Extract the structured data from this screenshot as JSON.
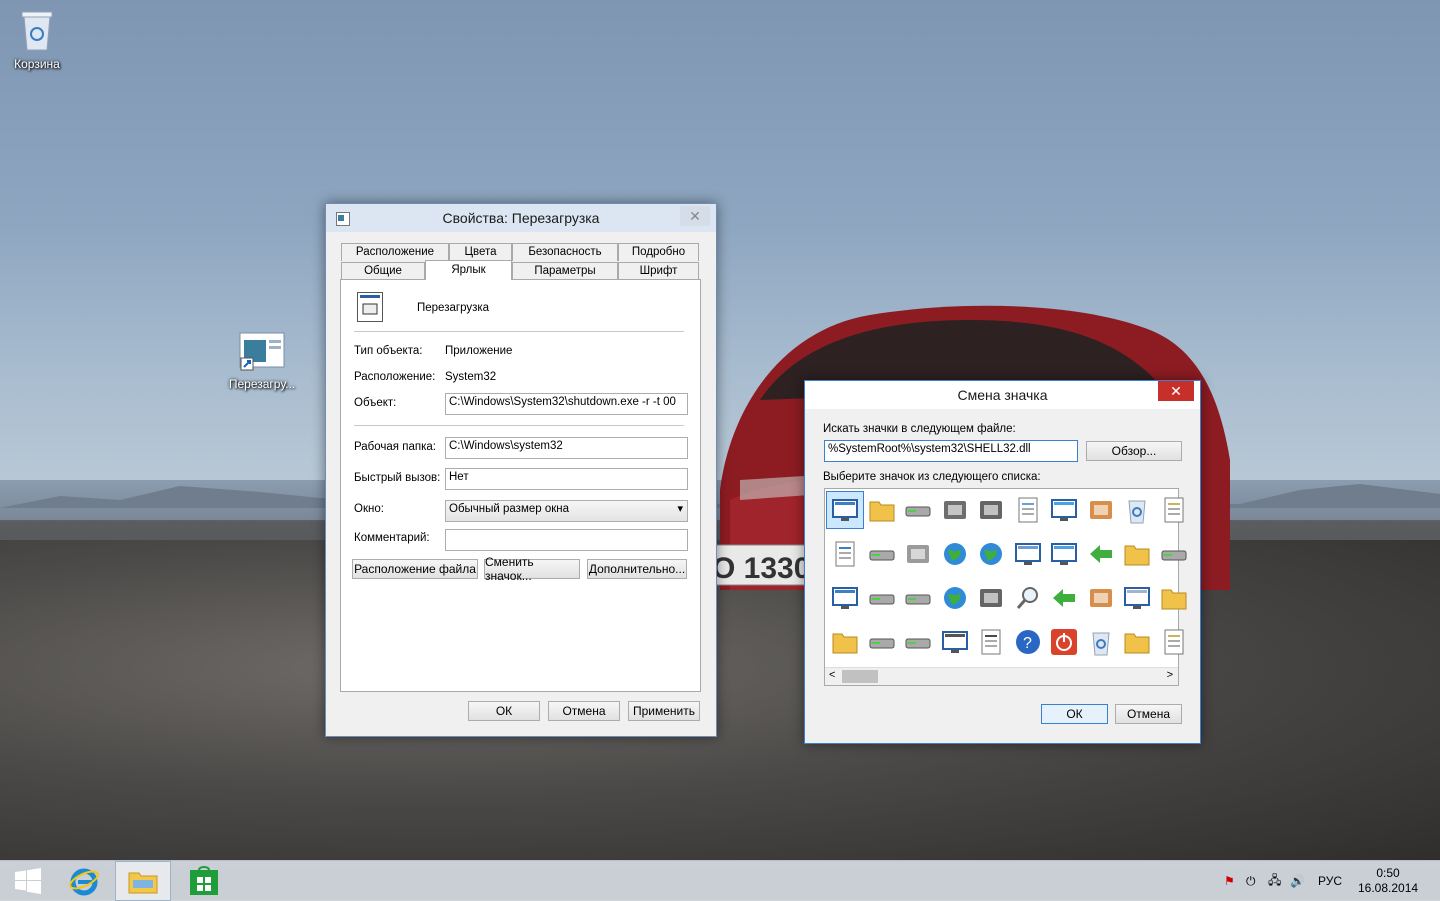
{
  "desktop": {
    "icons": [
      {
        "label": "Корзина"
      },
      {
        "label": "Перезагру..."
      }
    ],
    "plate_text": "O 1330"
  },
  "properties_dialog": {
    "title": "Свойства: Перезагрузка",
    "close": "✕",
    "tabs_row1": [
      "Расположение",
      "Цвета",
      "Безопасность",
      "Подробно"
    ],
    "tabs_row2": [
      "Общие",
      "Ярлык",
      "Параметры",
      "Шрифт"
    ],
    "name": "Перезагрузка",
    "rows": {
      "type_label": "Тип объекта:",
      "type_value": "Приложение",
      "location_label": "Расположение:",
      "location_value": "System32",
      "object_label": "Объект:",
      "object_value": "C:\\Windows\\System32\\shutdown.exe -r -t 00",
      "workdir_label": "Рабочая папка:",
      "workdir_value": "C:\\Windows\\system32",
      "hotkey_label": "Быстрый вызов:",
      "hotkey_value": "Нет",
      "window_label": "Окно:",
      "window_value": "Обычный размер окна",
      "comment_label": "Комментарий:",
      "comment_value": ""
    },
    "buttons": {
      "file_location": "Расположение файла",
      "change_icon": "Сменить значок...",
      "advanced": "Дополнительно...",
      "ok": "ОК",
      "cancel": "Отмена",
      "apply": "Применить"
    }
  },
  "change_icon_dialog": {
    "title": "Смена значка",
    "close": "✕",
    "search_label": "Искать значки в следующем файле:",
    "file_value": "%SystemRoot%\\system32\\SHELL32.dll",
    "browse": "Обзор...",
    "list_label": "Выберите значок из следующего списка:",
    "ok": "ОК",
    "cancel": "Отмена",
    "scroll_left": "<",
    "scroll_right": ">",
    "icons": [
      "app-window-icon",
      "folder-icon",
      "drive-icon",
      "chip-icon",
      "printer-icon",
      "clock-doc-icon",
      "screen-window-icon",
      "hand-icon",
      "recycle-bin-icon",
      "grid-doc-icon",
      "document-icon",
      "network-drive-icon",
      "network-server-icon",
      "globe-icon",
      "globe-monitor-icon",
      "control-monitor-icon",
      "cube-window-icon",
      "shortcut-arrow-icon",
      "folder-gear-icon",
      "drive-gear-icon",
      "blank-window-icon",
      "floppy-icon",
      "drive-x-icon",
      "cd-globe-icon",
      "network-icon",
      "magnifier-icon",
      "green-arrow-icon",
      "overlay-icon",
      "monitor-blue-icon",
      "font-folder-icon",
      "folder-open-icon",
      "drive-flat-icon",
      "cd-drive-icon",
      "monitor-pc-icon",
      "calculator-doc-icon",
      "help-icon",
      "power-icon",
      "empty-bin-icon",
      "folder-key-icon",
      "checklist-icon"
    ]
  },
  "taskbar": {
    "language": "РУС",
    "time": "0:50",
    "date": "16.08.2014"
  },
  "colors": {
    "accent_close": "#c7302a",
    "titlebar": "#dce6f2",
    "selection": "#cce8ff"
  }
}
